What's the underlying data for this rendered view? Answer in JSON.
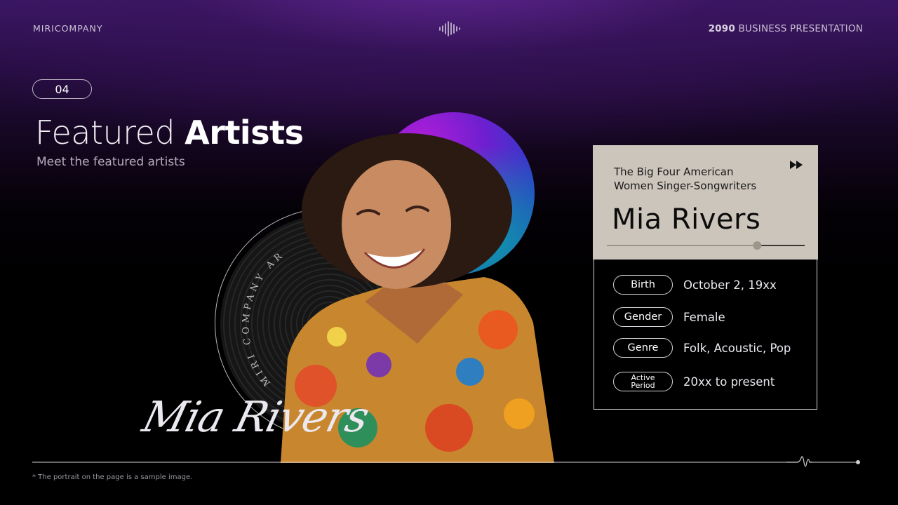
{
  "header": {
    "company": "MIRICOMPANY",
    "year": "2090",
    "presentation": "BUSINESS PRESENTATION",
    "logo_icon": "sound-wave-icon"
  },
  "section": {
    "number": "04",
    "title_light": "Featured",
    "title_bold": "Artists",
    "subtitle": "Meet the featured artists"
  },
  "artist": {
    "signature": "Mia Rivers",
    "vinyl_text": "MIRI COMPANY AR"
  },
  "card": {
    "subtitle_line1": "The Big Four American",
    "subtitle_line2": "Women Singer-Songwriters",
    "name": "Mia Rivers",
    "progress_fraction": 0.76,
    "next_icon": "fast-forward-icon",
    "info": [
      {
        "label": "Birth",
        "value": "October 2, 19xx"
      },
      {
        "label": "Gender",
        "value": "Female"
      },
      {
        "label": "Genre",
        "value": "Folk, Acoustic, Pop"
      },
      {
        "label_line1": "Active",
        "label_line2": "Period",
        "value": "20xx to present"
      }
    ]
  },
  "footer": {
    "note": "* The portrait on the page is a sample image."
  },
  "colors": {
    "card_bg": "#ccc5bb",
    "purple_glow": "#3a1763",
    "orb_magenta": "#b21ed8",
    "orb_teal": "#0f9aa8"
  }
}
